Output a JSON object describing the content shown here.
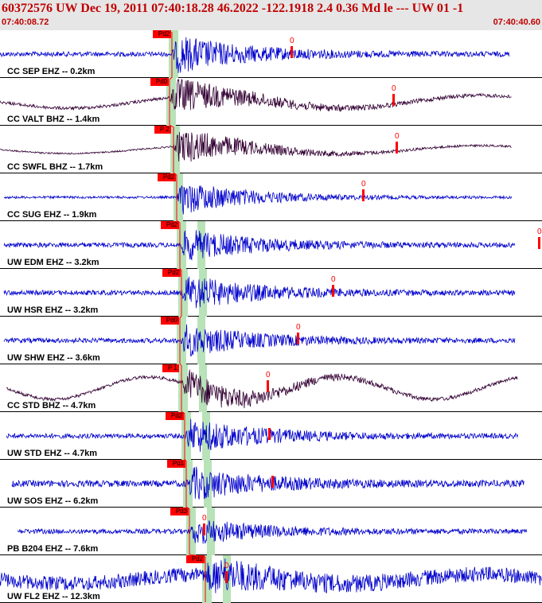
{
  "header": {
    "title": "60372576 UW Dec 19, 2011 07:40:18.28    46.2022 -122.1918  2.4 0.36 Md le --- UW 01   -1",
    "start_time": "07:40:08.72",
    "end_time": "07:40:40.60"
  },
  "colors": {
    "trace_blue": "#0000cc",
    "trace_dark": "#330033",
    "pick": "#ff0000",
    "window": "#b8e2b8",
    "header_bg": "#e6e6e6"
  },
  "chart_data": {
    "type": "line",
    "title": "60372576 UW Dec 19, 2011 07:40:18.28    46.2022 -122.1918  2.4 0.36 Md le --- UW 01   -1",
    "x_range_label": [
      "07:40:08.72",
      "07:40:40.60"
    ],
    "grid": true,
    "series": [
      {
        "name": "CC SEP EHZ -- 0.2km",
        "pick": "Pd2",
        "end_marker": "0"
      },
      {
        "name": "CC VALT BHZ -- 1.4km",
        "pick": "Pd0",
        "end_marker": "0"
      },
      {
        "name": "CC SWFL BHZ -- 1.7km",
        "pick": "P 2",
        "end_marker": "0"
      },
      {
        "name": "CC SUG EHZ -- 1.9km",
        "pick": "Pd2",
        "end_marker": "0"
      },
      {
        "name": "UW EDM EHZ -- 3.2km",
        "pick": "Pd2",
        "end_marker": "0"
      },
      {
        "name": "UW HSR EHZ -- 3.2km",
        "pick": "Pd2",
        "end_marker": "0"
      },
      {
        "name": "UW SHW EHZ -- 3.6km",
        "pick": "Pd0",
        "end_marker": "0"
      },
      {
        "name": "CC STD BHZ -- 4.7km",
        "pick": "P 1",
        "end_marker": "0"
      },
      {
        "name": "UW STD EHZ -- 4.7km",
        "pick": "Pd2",
        "end_marker": ""
      },
      {
        "name": "UW SOS EHZ -- 6.2km",
        "pick": "Pd1",
        "end_marker": ""
      },
      {
        "name": "PB B204 EHZ -- 7.6km",
        "pick": "Pd3",
        "end_marker": "0"
      },
      {
        "name": "UW FL2 EHZ -- 12.3km",
        "pick": "Pd2",
        "end_marker": "0"
      }
    ]
  }
}
